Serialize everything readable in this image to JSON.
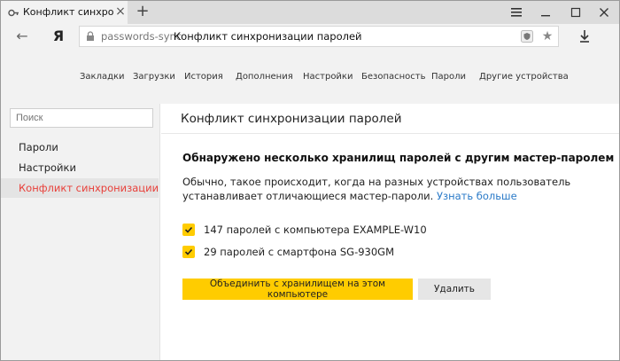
{
  "browser": {
    "tab_title": "Конфликт синхронизации",
    "tab_close": "×",
    "new_tab": "+",
    "address": {
      "host": "passwords-sync",
      "title": "Конфликт синхронизации паролей"
    },
    "logo_letter": "Я",
    "back": "←",
    "star": "★"
  },
  "topnav": {
    "items": [
      "Закладки",
      "Загрузки",
      "История",
      "Дополнения",
      "Настройки",
      "Безопасность",
      "Пароли",
      "Другие устройства"
    ]
  },
  "sidebar": {
    "search_placeholder": "Поиск",
    "items": [
      "Пароли",
      "Настройки",
      "Конфликт синхронизации"
    ],
    "active_index": 2
  },
  "main": {
    "page_title": "Конфликт синхронизации паролей",
    "heading": "Обнаружено несколько хранилищ паролей с другим мастер-паролем",
    "description": "Обычно, такое происходит, когда на разных устройствах пользователь устанавливает отличающиеся мастер-пароли.",
    "learn_more": "Узнать больше",
    "options": [
      {
        "label": "147 паролей с компьютера  EXAMPLE-W10",
        "checked": true
      },
      {
        "label": "29 паролей с смартфона SG-930GM",
        "checked": true
      }
    ],
    "merge_button": "Объединить с хранилищем на этом компьютере",
    "delete_button": "Удалить"
  },
  "colors": {
    "accent": "#ffcc00",
    "active_text": "#e8403a",
    "link": "#2a7ac8"
  }
}
